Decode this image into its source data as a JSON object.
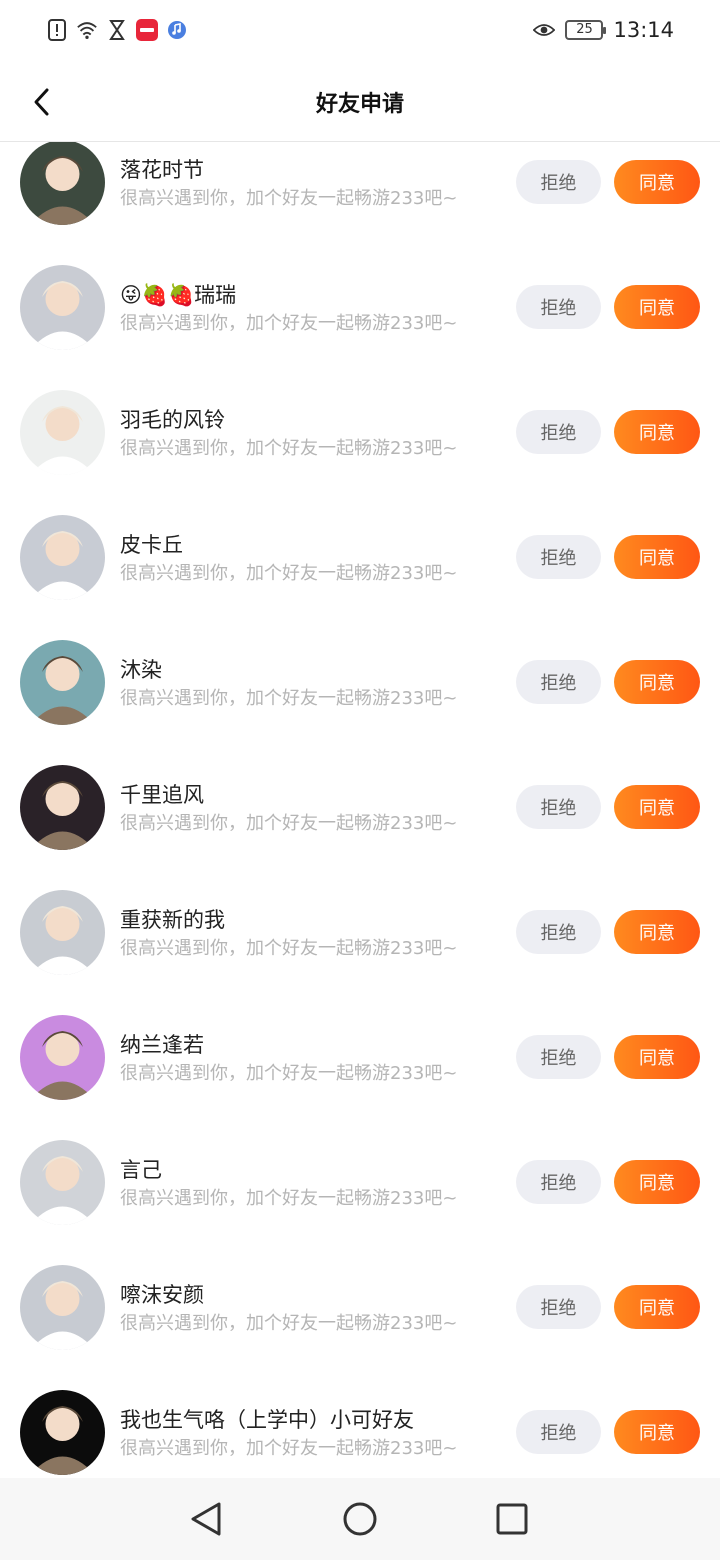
{
  "status_bar": {
    "time": "13:14",
    "battery": "25",
    "left_icons": [
      "alert-icon",
      "wifi-icon",
      "hourglass-icon",
      "xiaohongshu-app-icon",
      "music-app-icon"
    ],
    "right_icons": [
      "eye-icon",
      "battery-icon"
    ]
  },
  "header": {
    "title": "好友申请",
    "back_icon": "chevron-left-icon"
  },
  "requests": [
    {
      "name": "落花时节",
      "message": "很高兴遇到你，加个好友一起畅游233吧~",
      "reject_label": "拒绝",
      "accept_label": "同意",
      "avatar_color": "#3d4a3f"
    },
    {
      "name": "😜🍓🍓瑞瑞",
      "message": "很高兴遇到你，加个好友一起畅游233吧~",
      "reject_label": "拒绝",
      "accept_label": "同意",
      "avatar_color": "#c9ccd3"
    },
    {
      "name": "羽毛的风铃",
      "message": "很高兴遇到你，加个好友一起畅游233吧~",
      "reject_label": "拒绝",
      "accept_label": "同意",
      "avatar_color": "#eef0ef"
    },
    {
      "name": "皮卡丘",
      "message": "很高兴遇到你，加个好友一起畅游233吧~",
      "reject_label": "拒绝",
      "accept_label": "同意",
      "avatar_color": "#c8ccd4"
    },
    {
      "name": "沐染",
      "message": "很高兴遇到你，加个好友一起畅游233吧~",
      "reject_label": "拒绝",
      "accept_label": "同意",
      "avatar_color": "#7aa9b0"
    },
    {
      "name": "千里追风",
      "message": "很高兴遇到你，加个好友一起畅游233吧~",
      "reject_label": "拒绝",
      "accept_label": "同意",
      "avatar_color": "#2a2228"
    },
    {
      "name": "重获新的我",
      "message": "很高兴遇到你，加个好友一起畅游233吧~",
      "reject_label": "拒绝",
      "accept_label": "同意",
      "avatar_color": "#c8ccd2"
    },
    {
      "name": "纳兰逢若",
      "message": "很高兴遇到你，加个好友一起畅游233吧~",
      "reject_label": "拒绝",
      "accept_label": "同意",
      "avatar_color": "#c98be0"
    },
    {
      "name": "言己",
      "message": "很高兴遇到你，加个好友一起畅游233吧~",
      "reject_label": "拒绝",
      "accept_label": "同意",
      "avatar_color": "#d0d3d8"
    },
    {
      "name": "嚓沫安颜",
      "message": "很高兴遇到你，加个好友一起畅游233吧~",
      "reject_label": "拒绝",
      "accept_label": "同意",
      "avatar_color": "#c7cbd2"
    },
    {
      "name": "我也生气咯（上学中）小可好友",
      "message": "很高兴遇到你，加个好友一起畅游233吧~",
      "reject_label": "拒绝",
      "accept_label": "同意",
      "avatar_color": "#0c0c0c"
    }
  ],
  "colors": {
    "accent": "#ff6a1a",
    "reject_bg": "#edeef3",
    "muted_text": "#b5b5b5"
  },
  "nav_bar": {
    "icons": [
      "back-triangle-icon",
      "home-circle-icon",
      "recents-square-icon"
    ]
  }
}
